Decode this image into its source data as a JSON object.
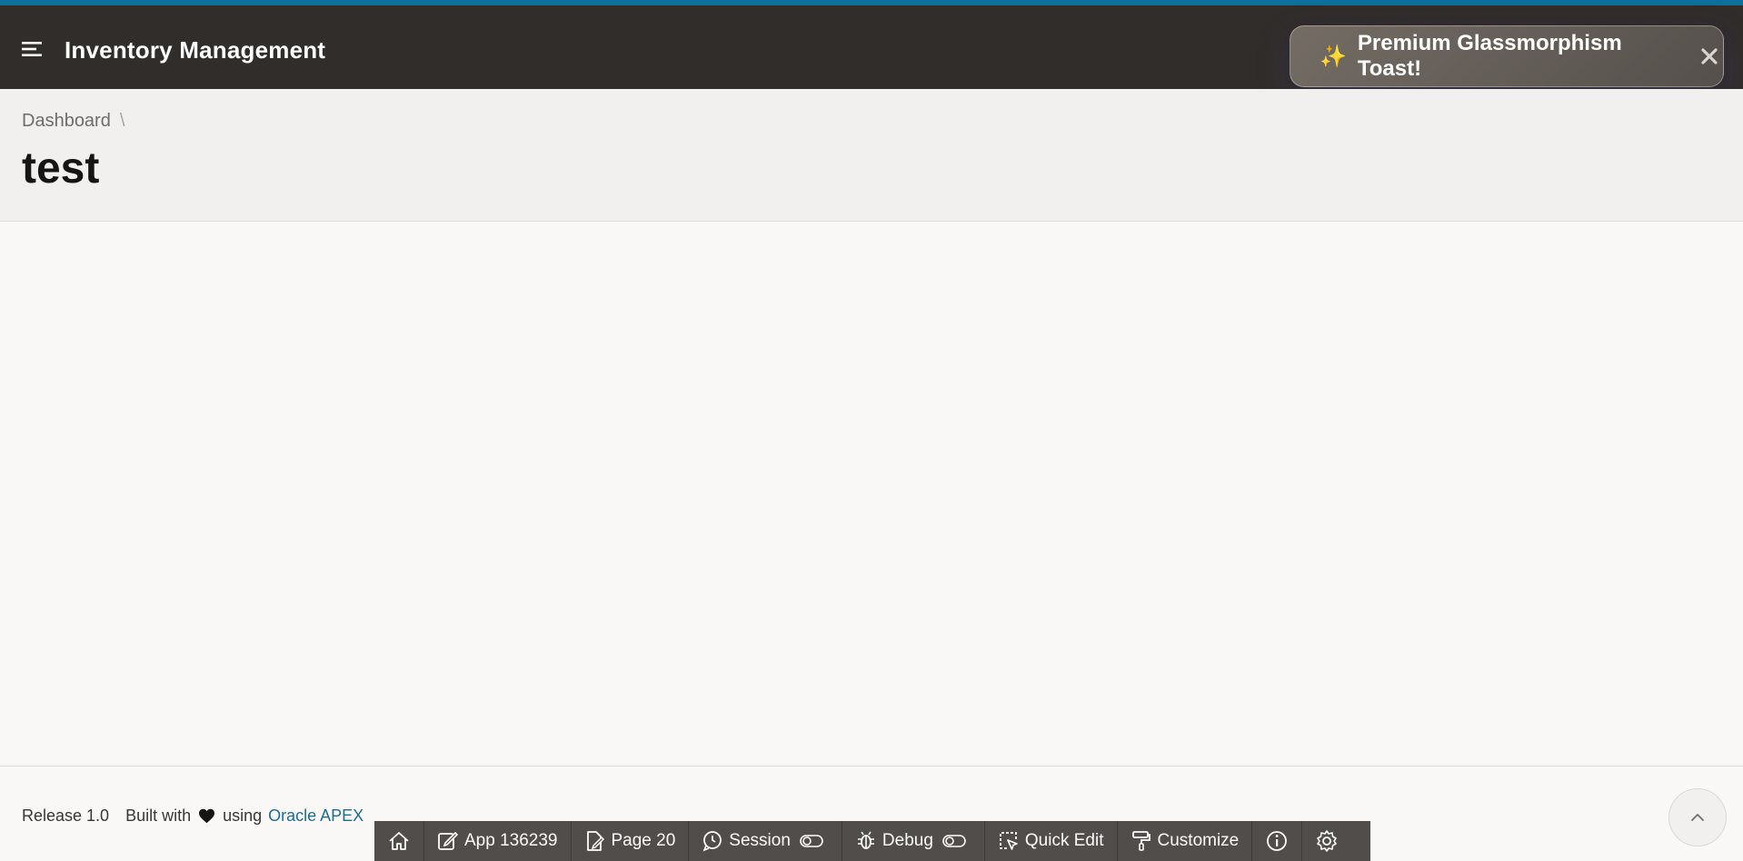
{
  "header": {
    "title": "Inventory Management",
    "menu_icon": "hamburger-icon"
  },
  "toast": {
    "icon": "✨",
    "message": "Premium Glassmorphism Toast!",
    "close_icon": "close-icon"
  },
  "breadcrumb": {
    "items": [
      "Dashboard"
    ],
    "separator": "\\"
  },
  "page": {
    "title": "test"
  },
  "footer": {
    "release": "Release 1.0",
    "built_with": "Built with",
    "using": "using",
    "link_text": "Oracle APEX",
    "heart_icon": "heart-icon"
  },
  "devbar": {
    "home_icon": "home-icon",
    "app": "App 136239",
    "page": "Page 20",
    "session": "Session",
    "debug": "Debug",
    "quick_edit": "Quick Edit",
    "customize": "Customize",
    "info_icon": "info-icon",
    "settings_icon": "gear-icon"
  },
  "colors": {
    "header_bg": "#312d2a",
    "accent": "#0d6f9a",
    "link": "#1b6d96",
    "devbar_bg": "#514d4a"
  }
}
